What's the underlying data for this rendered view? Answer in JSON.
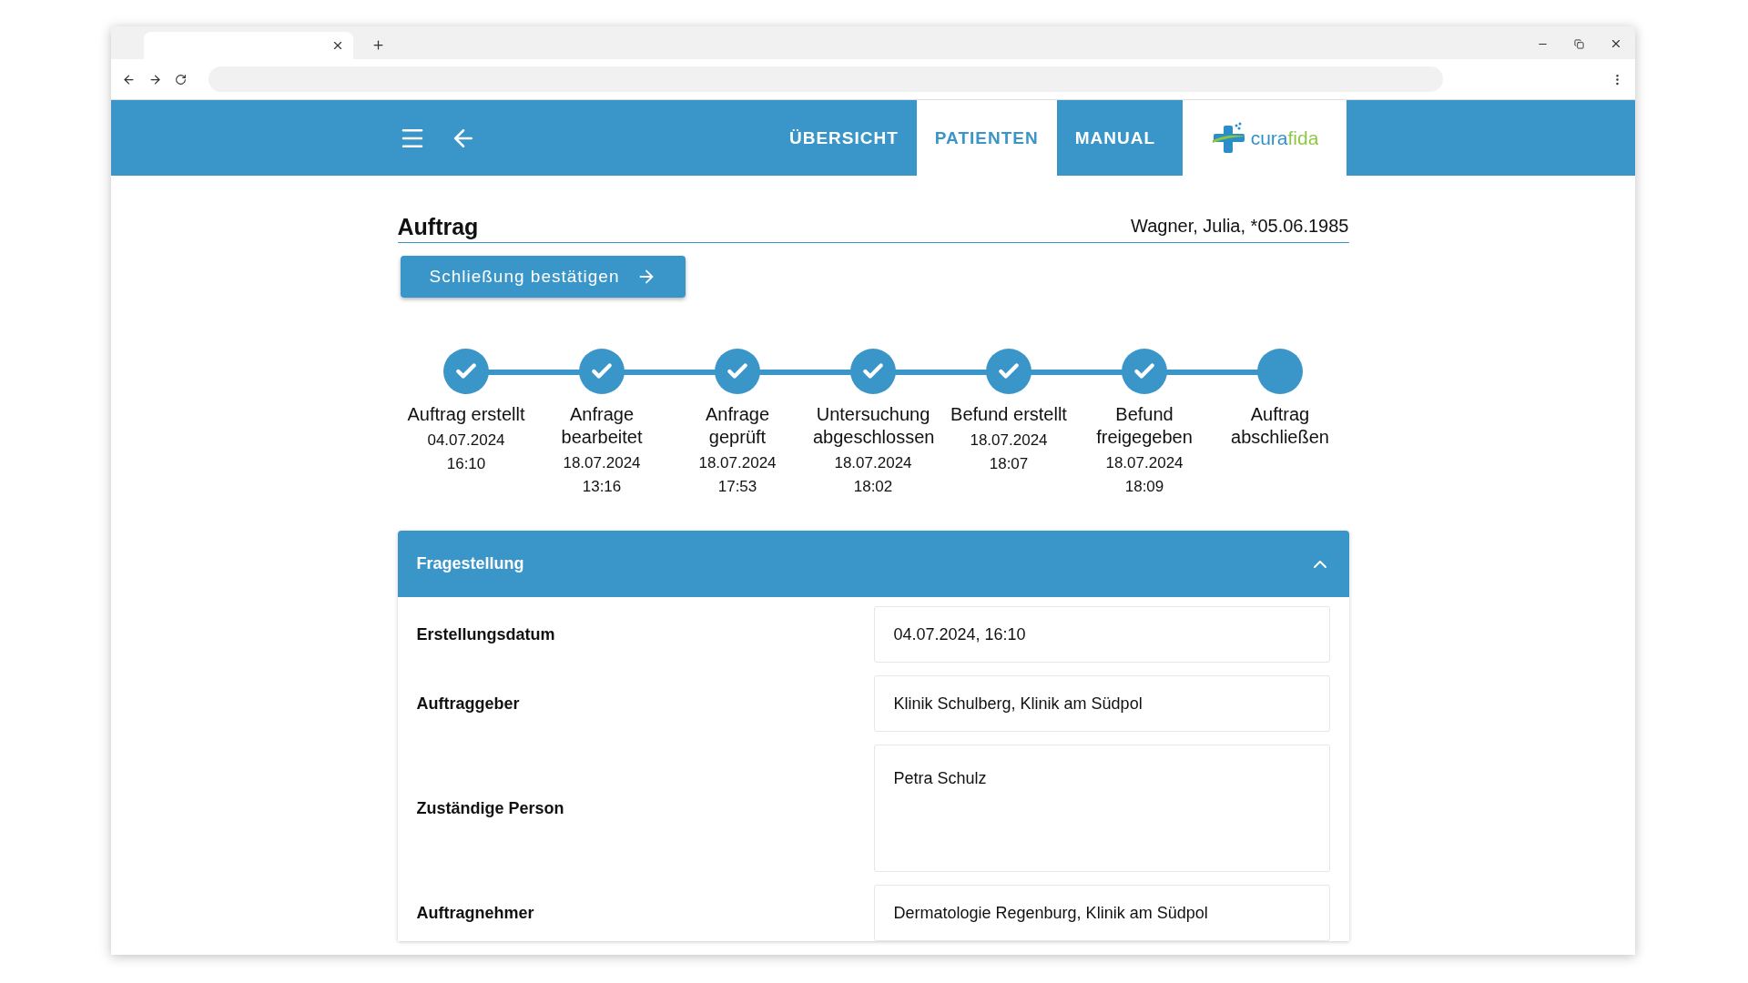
{
  "nav": {
    "items": [
      {
        "label": "ÜBERSICHT",
        "selected": false
      },
      {
        "label": "PATIENTEN",
        "selected": true
      },
      {
        "label": "MANUAL",
        "selected": false
      }
    ],
    "logo": "curafida"
  },
  "page": {
    "title": "Auftrag",
    "patient": "Wagner, Julia, *05.06.1985",
    "action": "Schließung bestätigen"
  },
  "steps": [
    {
      "label": "Auftrag erstellt",
      "date": "04.07.2024",
      "time": "16:10",
      "done": true
    },
    {
      "label": "Anfrage bearbeitet",
      "date": "18.07.2024",
      "time": "13:16",
      "done": true
    },
    {
      "label": "Anfrage geprüft",
      "date": "18.07.2024",
      "time": "17:53",
      "done": true
    },
    {
      "label": "Untersuchung abgeschlossen",
      "date": "18.07.2024",
      "time": "18:02",
      "done": true
    },
    {
      "label": "Befund erstellt",
      "date": "18.07.2024",
      "time": "18:07",
      "done": true
    },
    {
      "label": "Befund freigegeben",
      "date": "18.07.2024",
      "time": "18:09",
      "done": true
    },
    {
      "label": "Auftrag abschließen",
      "done": false
    }
  ],
  "panel": {
    "title": "Fragestellung",
    "expanded": true,
    "fields": [
      {
        "label": "Erstellungsdatum",
        "value": "04.07.2024, 16:10",
        "kind": "line"
      },
      {
        "label": "Auftraggeber",
        "value": "Klinik Schulberg, Klinik am Südpol",
        "kind": "line"
      },
      {
        "label": "Zuständige Person",
        "value": "Petra Schulz",
        "kind": "area"
      },
      {
        "label": "Auftragnehmer",
        "value": "Dermatologie Regenburg, Klinik am Südpol",
        "kind": "line"
      }
    ]
  }
}
